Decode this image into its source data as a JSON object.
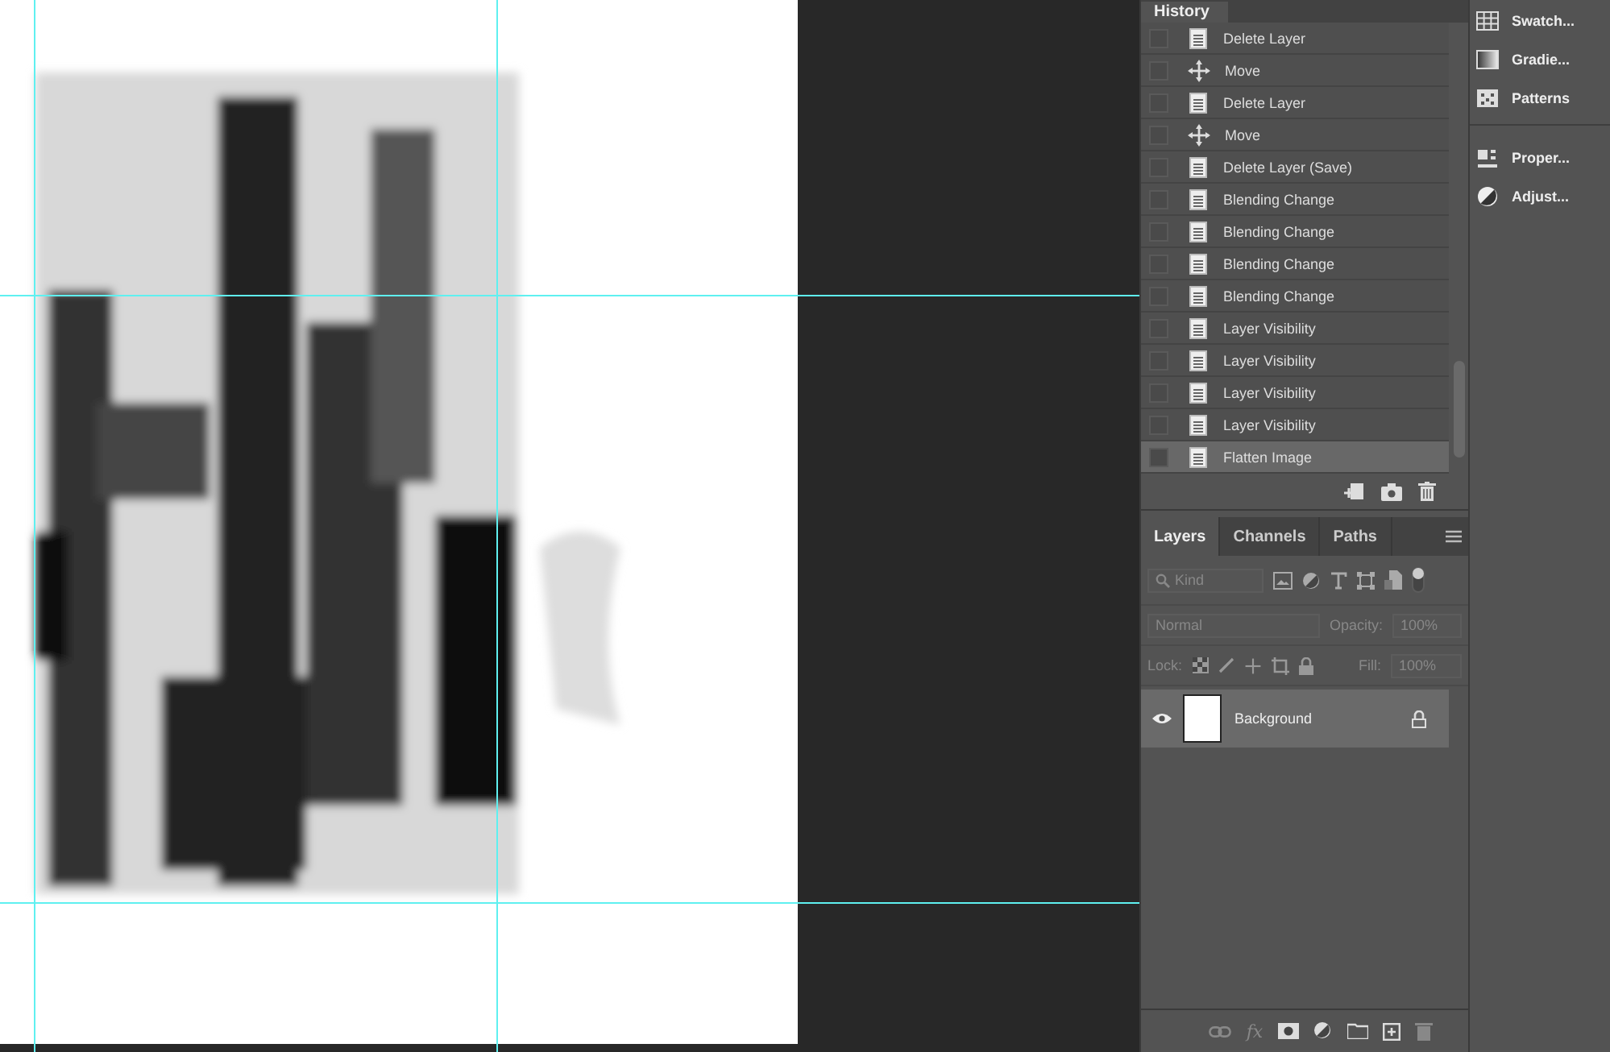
{
  "history": {
    "title": "History",
    "items": [
      {
        "label": "Delete Layer",
        "kind": "document",
        "selected": false
      },
      {
        "label": "Move",
        "kind": "move",
        "selected": false
      },
      {
        "label": "Delete Layer",
        "kind": "document",
        "selected": false
      },
      {
        "label": "Move",
        "kind": "move",
        "selected": false
      },
      {
        "label": "Delete Layer (Save)",
        "kind": "document",
        "selected": false
      },
      {
        "label": "Blending Change",
        "kind": "document",
        "selected": false
      },
      {
        "label": "Blending Change",
        "kind": "document",
        "selected": false
      },
      {
        "label": "Blending Change",
        "kind": "document",
        "selected": false
      },
      {
        "label": "Blending Change",
        "kind": "document",
        "selected": false
      },
      {
        "label": "Layer Visibility",
        "kind": "document",
        "selected": false
      },
      {
        "label": "Layer Visibility",
        "kind": "document",
        "selected": false
      },
      {
        "label": "Layer Visibility",
        "kind": "document",
        "selected": false
      },
      {
        "label": "Layer Visibility",
        "kind": "document",
        "selected": false
      },
      {
        "label": "Flatten Image",
        "kind": "document",
        "selected": true
      }
    ]
  },
  "layers_panel": {
    "tabs": [
      {
        "label": "Layers",
        "selected": true
      },
      {
        "label": "Channels",
        "selected": false
      },
      {
        "label": "Paths",
        "selected": false
      }
    ],
    "filter": {
      "value": "Kind"
    },
    "blend_mode": "Normal",
    "opacity": {
      "label": "Opacity:",
      "value": "100%"
    },
    "lock_label": "Lock:",
    "fill": {
      "label": "Fill:",
      "value": "100%"
    },
    "layers": [
      {
        "name": "Background",
        "visible": true,
        "locked": true,
        "selected": true
      }
    ],
    "fx_label": "fx"
  },
  "dock": {
    "items": [
      {
        "label": "Swatch...",
        "kind": "swatches"
      },
      {
        "label": "Gradie...",
        "kind": "gradients"
      },
      {
        "label": "Patterns",
        "kind": "patterns"
      },
      {
        "label": "Proper...",
        "kind": "properties"
      },
      {
        "label": "Adjust...",
        "kind": "adjustments"
      }
    ]
  }
}
